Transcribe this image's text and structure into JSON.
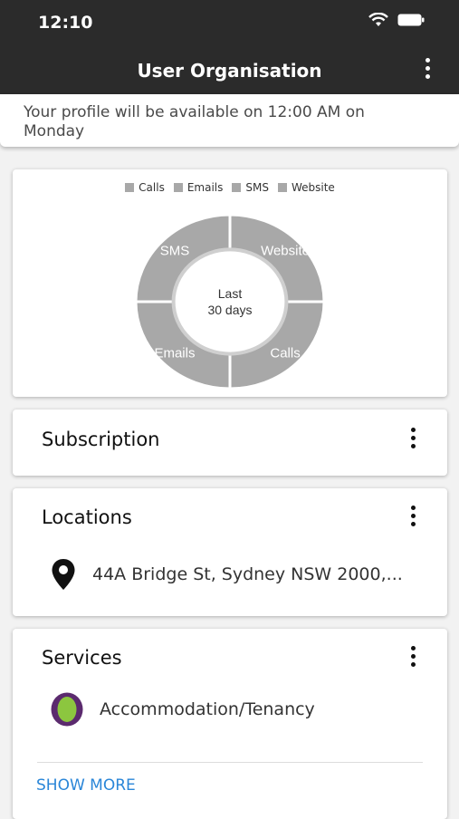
{
  "status_bar": {
    "time": "12:10"
  },
  "header": {
    "title": "User Organisation",
    "menu_icon": "more-vertical-icon"
  },
  "notice": {
    "text": "Your profile will be available on 12:00 AM on Monday"
  },
  "chart_data": {
    "type": "pie",
    "categories": [
      "Calls",
      "Emails",
      "SMS",
      "Website"
    ],
    "values": [
      25,
      25,
      25,
      25
    ],
    "center_label": [
      "Last",
      "30 days"
    ],
    "legend_position": "top",
    "colors": [
      "#a8a8a8",
      "#a8a8a8",
      "#a8a8a8",
      "#a8a8a8"
    ]
  },
  "subscription": {
    "title": "Subscription"
  },
  "locations": {
    "title": "Locations",
    "address": "44A Bridge St, Sydney NSW 2000,..."
  },
  "services": {
    "title": "Services",
    "item": "Accommodation/Tenancy",
    "show_more": "SHOW MORE"
  },
  "colors": {
    "appbar": "#2b2b2b",
    "accent": "#2a86d8",
    "service_icon_outer": "#5b2a6e",
    "service_icon_inner": "#8cc63f"
  }
}
